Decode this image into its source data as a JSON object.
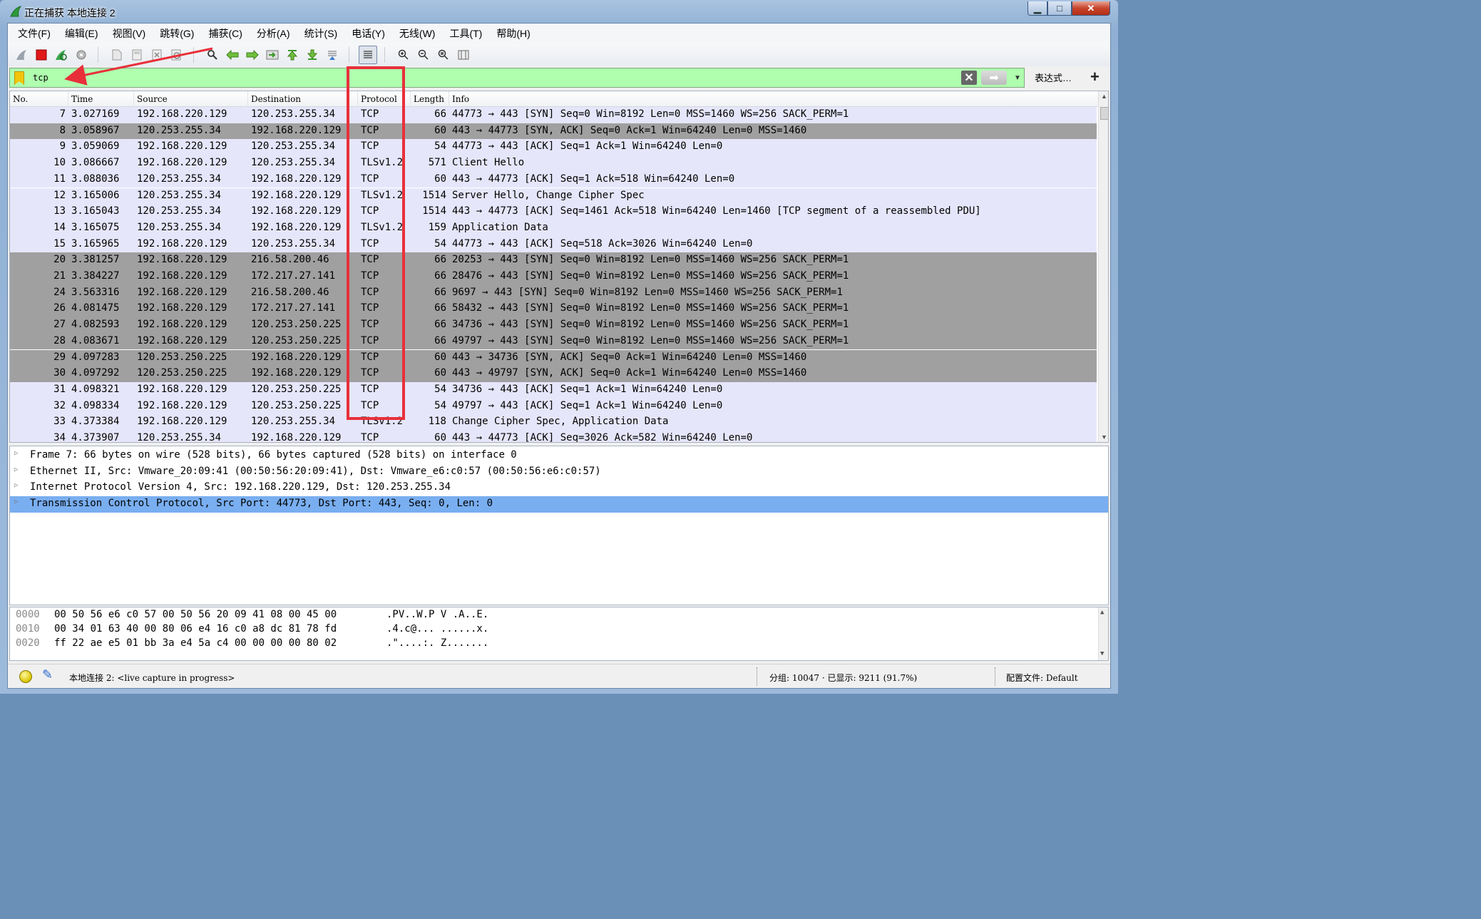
{
  "window": {
    "title": "正在捕获 本地连接 2",
    "minimize": "▁",
    "maximize": "□",
    "close": "✕"
  },
  "menu": [
    "文件(F)",
    "编辑(E)",
    "视图(V)",
    "跳转(G)",
    "捕获(C)",
    "分析(A)",
    "统计(S)",
    "电话(Y)",
    "无线(W)",
    "工具(T)",
    "帮助(H)"
  ],
  "toolbar_icons": [
    "shark-fin-icon",
    "stop-capture-icon",
    "restart-capture-icon",
    "capture-options-icon",
    "open-file-icon",
    "save-file-icon",
    "close-file-icon",
    "reload-icon",
    "find-packet-icon",
    "go-back-icon",
    "go-forward-icon",
    "go-to-packet-icon",
    "go-first-icon",
    "go-last-icon",
    "autoscroll-icon",
    "colorize-icon",
    "zoom-in-icon",
    "zoom-out-icon",
    "zoom-normal-icon",
    "resize-columns-icon"
  ],
  "filter": {
    "value": "tcp",
    "expression_label": "表达式…",
    "add_label": "+"
  },
  "columns": {
    "no": "No.",
    "time": "Time",
    "source": "Source",
    "destination": "Destination",
    "protocol": "Protocol",
    "length": "Length",
    "info": "Info"
  },
  "packets": [
    {
      "no": "7",
      "time": "3.027169",
      "src": "192.168.220.129",
      "dst": "120.253.255.34",
      "proto": "TCP",
      "len": "66",
      "info": "44773 → 443 [SYN] Seq=0 Win=8192 Len=0 MSS=1460 WS=256 SACK_PERM=1",
      "shade": "sel"
    },
    {
      "no": "8",
      "time": "3.058967",
      "src": "120.253.255.34",
      "dst": "192.168.220.129",
      "proto": "TCP",
      "len": "60",
      "info": "443 → 44773 [SYN, ACK] Seq=0 Ack=1 Win=64240 Len=0 MSS=1460",
      "shade": "dark"
    },
    {
      "no": "9",
      "time": "3.059069",
      "src": "192.168.220.129",
      "dst": "120.253.255.34",
      "proto": "TCP",
      "len": "54",
      "info": "44773 → 443 [ACK] Seq=1 Ack=1 Win=64240 Len=0",
      "shade": "light"
    },
    {
      "no": "10",
      "time": "3.086667",
      "src": "192.168.220.129",
      "dst": "120.253.255.34",
      "proto": "TLSv1.2",
      "len": "571",
      "info": "Client Hello",
      "shade": "light"
    },
    {
      "no": "11",
      "time": "3.088036",
      "src": "120.253.255.34",
      "dst": "192.168.220.129",
      "proto": "TCP",
      "len": "60",
      "info": "443 → 44773 [ACK] Seq=1 Ack=518 Win=64240 Len=0",
      "shade": "light"
    },
    {
      "no": "12",
      "time": "3.165006",
      "src": "120.253.255.34",
      "dst": "192.168.220.129",
      "proto": "TLSv1.2",
      "len": "1514",
      "info": "Server Hello, Change Cipher Spec",
      "shade": "light"
    },
    {
      "no": "13",
      "time": "3.165043",
      "src": "120.253.255.34",
      "dst": "192.168.220.129",
      "proto": "TCP",
      "len": "1514",
      "info": "443 → 44773 [ACK] Seq=1461 Ack=518 Win=64240 Len=1460 [TCP segment of a reassembled PDU]",
      "shade": "light"
    },
    {
      "no": "14",
      "time": "3.165075",
      "src": "120.253.255.34",
      "dst": "192.168.220.129",
      "proto": "TLSv1.2",
      "len": "159",
      "info": "Application Data",
      "shade": "light"
    },
    {
      "no": "15",
      "time": "3.165965",
      "src": "192.168.220.129",
      "dst": "120.253.255.34",
      "proto": "TCP",
      "len": "54",
      "info": "44773 → 443 [ACK] Seq=518 Ack=3026 Win=64240 Len=0",
      "shade": "light"
    },
    {
      "no": "20",
      "time": "3.381257",
      "src": "192.168.220.129",
      "dst": "216.58.200.46",
      "proto": "TCP",
      "len": "66",
      "info": "20253 → 443 [SYN] Seq=0 Win=8192 Len=0 MSS=1460 WS=256 SACK_PERM=1",
      "shade": "dark"
    },
    {
      "no": "21",
      "time": "3.384227",
      "src": "192.168.220.129",
      "dst": "172.217.27.141",
      "proto": "TCP",
      "len": "66",
      "info": "28476 → 443 [SYN] Seq=0 Win=8192 Len=0 MSS=1460 WS=256 SACK_PERM=1",
      "shade": "dark"
    },
    {
      "no": "24",
      "time": "3.563316",
      "src": "192.168.220.129",
      "dst": "216.58.200.46",
      "proto": "TCP",
      "len": "66",
      "info": "9697 → 443 [SYN] Seq=0 Win=8192 Len=0 MSS=1460 WS=256 SACK_PERM=1",
      "shade": "dark"
    },
    {
      "no": "26",
      "time": "4.081475",
      "src": "192.168.220.129",
      "dst": "172.217.27.141",
      "proto": "TCP",
      "len": "66",
      "info": "58432 → 443 [SYN] Seq=0 Win=8192 Len=0 MSS=1460 WS=256 SACK_PERM=1",
      "shade": "dark"
    },
    {
      "no": "27",
      "time": "4.082593",
      "src": "192.168.220.129",
      "dst": "120.253.250.225",
      "proto": "TCP",
      "len": "66",
      "info": "34736 → 443 [SYN] Seq=0 Win=8192 Len=0 MSS=1460 WS=256 SACK_PERM=1",
      "shade": "dark"
    },
    {
      "no": "28",
      "time": "4.083671",
      "src": "192.168.220.129",
      "dst": "120.253.250.225",
      "proto": "TCP",
      "len": "66",
      "info": "49797 → 443 [SYN] Seq=0 Win=8192 Len=0 MSS=1460 WS=256 SACK_PERM=1",
      "shade": "dark"
    },
    {
      "no": "29",
      "time": "4.097283",
      "src": "120.253.250.225",
      "dst": "192.168.220.129",
      "proto": "TCP",
      "len": "60",
      "info": "443 → 34736 [SYN, ACK] Seq=0 Ack=1 Win=64240 Len=0 MSS=1460",
      "shade": "dark"
    },
    {
      "no": "30",
      "time": "4.097292",
      "src": "120.253.250.225",
      "dst": "192.168.220.129",
      "proto": "TCP",
      "len": "60",
      "info": "443 → 49797 [SYN, ACK] Seq=0 Ack=1 Win=64240 Len=0 MSS=1460",
      "shade": "dark"
    },
    {
      "no": "31",
      "time": "4.098321",
      "src": "192.168.220.129",
      "dst": "120.253.250.225",
      "proto": "TCP",
      "len": "54",
      "info": "34736 → 443 [ACK] Seq=1 Ack=1 Win=64240 Len=0",
      "shade": "light"
    },
    {
      "no": "32",
      "time": "4.098334",
      "src": "192.168.220.129",
      "dst": "120.253.250.225",
      "proto": "TCP",
      "len": "54",
      "info": "49797 → 443 [ACK] Seq=1 Ack=1 Win=64240 Len=0",
      "shade": "light"
    },
    {
      "no": "33",
      "time": "4.373384",
      "src": "192.168.220.129",
      "dst": "120.253.255.34",
      "proto": "TLSv1.2",
      "len": "118",
      "info": "Change Cipher Spec, Application Data",
      "shade": "light"
    },
    {
      "no": "34",
      "time": "4.373907",
      "src": "120.253.255.34",
      "dst": "192.168.220.129",
      "proto": "TCP",
      "len": "60",
      "info": "443 → 44773 [ACK] Seq=3026 Ack=582 Win=64240 Len=0",
      "shade": "light"
    }
  ],
  "details": [
    {
      "text": "Frame 7: 66 bytes on wire (528 bits), 66 bytes captured (528 bits) on interface 0",
      "selected": false
    },
    {
      "text": "Ethernet II, Src: Vmware_20:09:41 (00:50:56:20:09:41), Dst: Vmware_e6:c0:57 (00:50:56:e6:c0:57)",
      "selected": false
    },
    {
      "text": "Internet Protocol Version 4, Src: 192.168.220.129, Dst: 120.253.255.34",
      "selected": false
    },
    {
      "text": "Transmission Control Protocol, Src Port: 44773, Dst Port: 443, Seq: 0, Len: 0",
      "selected": true
    }
  ],
  "bytes": [
    {
      "offset": "0000",
      "hex": "00 50 56 e6 c0 57 00 50  56 20 09 41 08 00 45 00",
      "ascii": ".PV..W.P V .A..E."
    },
    {
      "offset": "0010",
      "hex": "00 34 01 63 40 00 80 06  e4 16 c0 a8 dc 81 78 fd",
      "ascii": ".4.c@... ......x."
    },
    {
      "offset": "0020",
      "hex": "ff 22 ae e5 01 bb 3a e4  5a c4 00 00 00 00 80 02",
      "ascii": ".\"....:. Z......."
    }
  ],
  "status": {
    "capture_text": "本地连接 2: <live capture in progress>",
    "packets_text": "分组: 10047 · 已显示: 9211 (91.7%)",
    "profile_text": "配置文件: Default"
  },
  "colors": {
    "filter_bg": "#afffaf",
    "row_light": "#e6e6fb",
    "row_dark": "#a0a0a0",
    "detail_selected": "#79aef0",
    "annotation": "#e8303a"
  }
}
